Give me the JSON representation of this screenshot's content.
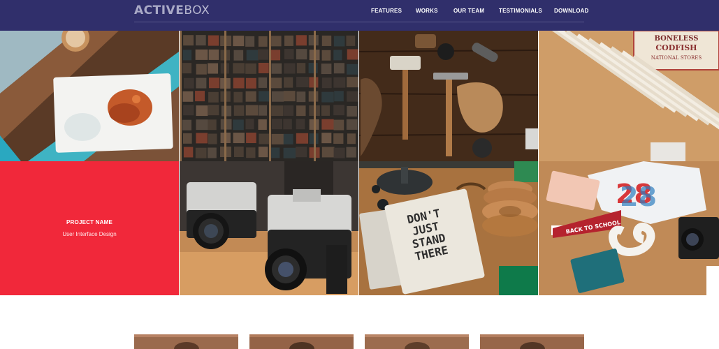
{
  "brand": {
    "part1": "ACTIVE",
    "part2": "BOX"
  },
  "nav": {
    "features": "FEATURES",
    "works": "WORKS",
    "our_team": "OUR TEAM",
    "testimonials": "TESTIMONIALS",
    "download": "DOWNLOAD"
  },
  "project": {
    "name": "PROJECT NAME",
    "category": "User Interface Design"
  },
  "photo_text": {
    "stamp": "BONELESS\nCODFISH\nNATIONAL STORES",
    "book": "DON'T\nJUST\nSTAND\nTHERE",
    "pennant": "BACK TO SCHOOL"
  },
  "colors": {
    "header_bg": "#302f6b",
    "accent_red": "#f1283a"
  }
}
